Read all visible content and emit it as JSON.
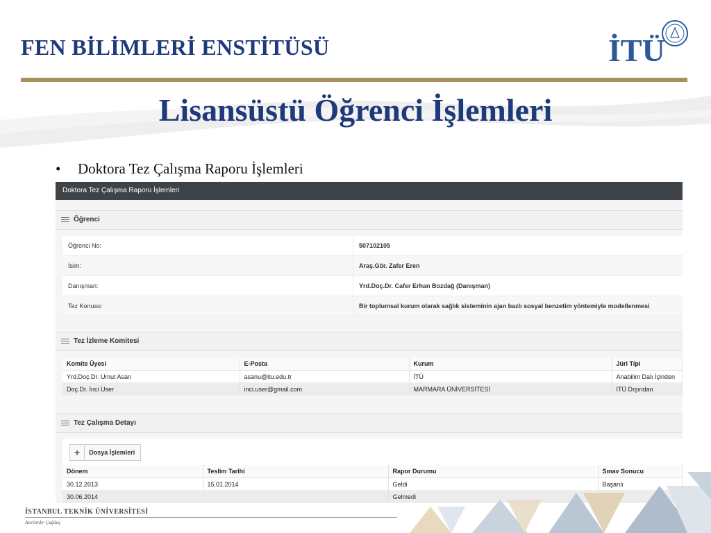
{
  "slide": {
    "institute": "FEN BİLİMLERİ ENSTİTÜSÜ",
    "logo_text": "İTÜ",
    "title": "Lisansüstü Öğrenci İşlemleri",
    "bullet": "Doktora Tez Çalışma Raporu İşlemleri",
    "footer_university": "İSTANBUL TEKNİK ÜNİVERSİTESİ",
    "footer_motto": "Asırlardır Çağdaş",
    "colors": {
      "title_blue": "#1f3a7a",
      "gold_bar": "#a89060",
      "header_dark": "#3e4348"
    }
  },
  "app": {
    "header": "Doktora Tez Çalışma Raporu İşlemleri",
    "student_section": {
      "title": "Öğrenci",
      "rows": [
        {
          "label": "Öğrenci No:",
          "value": "507102105"
        },
        {
          "label": "İsim:",
          "value": "Araş.Gör. Zafer Eren"
        },
        {
          "label": "Danışman:",
          "value": "Yrd.Doç.Dr. Cafer Erhan Bozdağ (Danışman)"
        },
        {
          "label": "Tez Konusu:",
          "value": "Bir toplumsal kurum olarak sağlık sisteminin ajan bazlı sosyal benzetim yöntemiyle modellenmesi"
        }
      ]
    },
    "committee_section": {
      "title": "Tez İzleme Komitesi",
      "columns": [
        "Komite Üyesi",
        "E-Posta",
        "Kurum",
        "Jüri Tipi"
      ],
      "rows": [
        [
          "Yrd.Doç.Dr. Umut Asan",
          "asanu@itu.edu.tr",
          "İTÜ",
          "Anabilim Dalı İçinden"
        ],
        [
          "Doç.Dr. İnci User",
          "inci.user@gmail.com",
          "MARMARA ÜNİVERSİTESİ",
          "İTÜ Dışından"
        ]
      ]
    },
    "detail_section": {
      "title": "Tez Çalışma Detayı",
      "file_button": "Dosya İşlemleri",
      "columns": [
        "Dönem",
        "Teslim Tarihi",
        "Rapor Durumu",
        "Sınav Sonucu"
      ],
      "rows": [
        [
          "30.12.2013",
          "15.01.2014",
          "Geldi",
          "Başarılı"
        ],
        [
          "30.06.2014",
          "",
          "Gelmedi",
          ""
        ]
      ]
    }
  }
}
